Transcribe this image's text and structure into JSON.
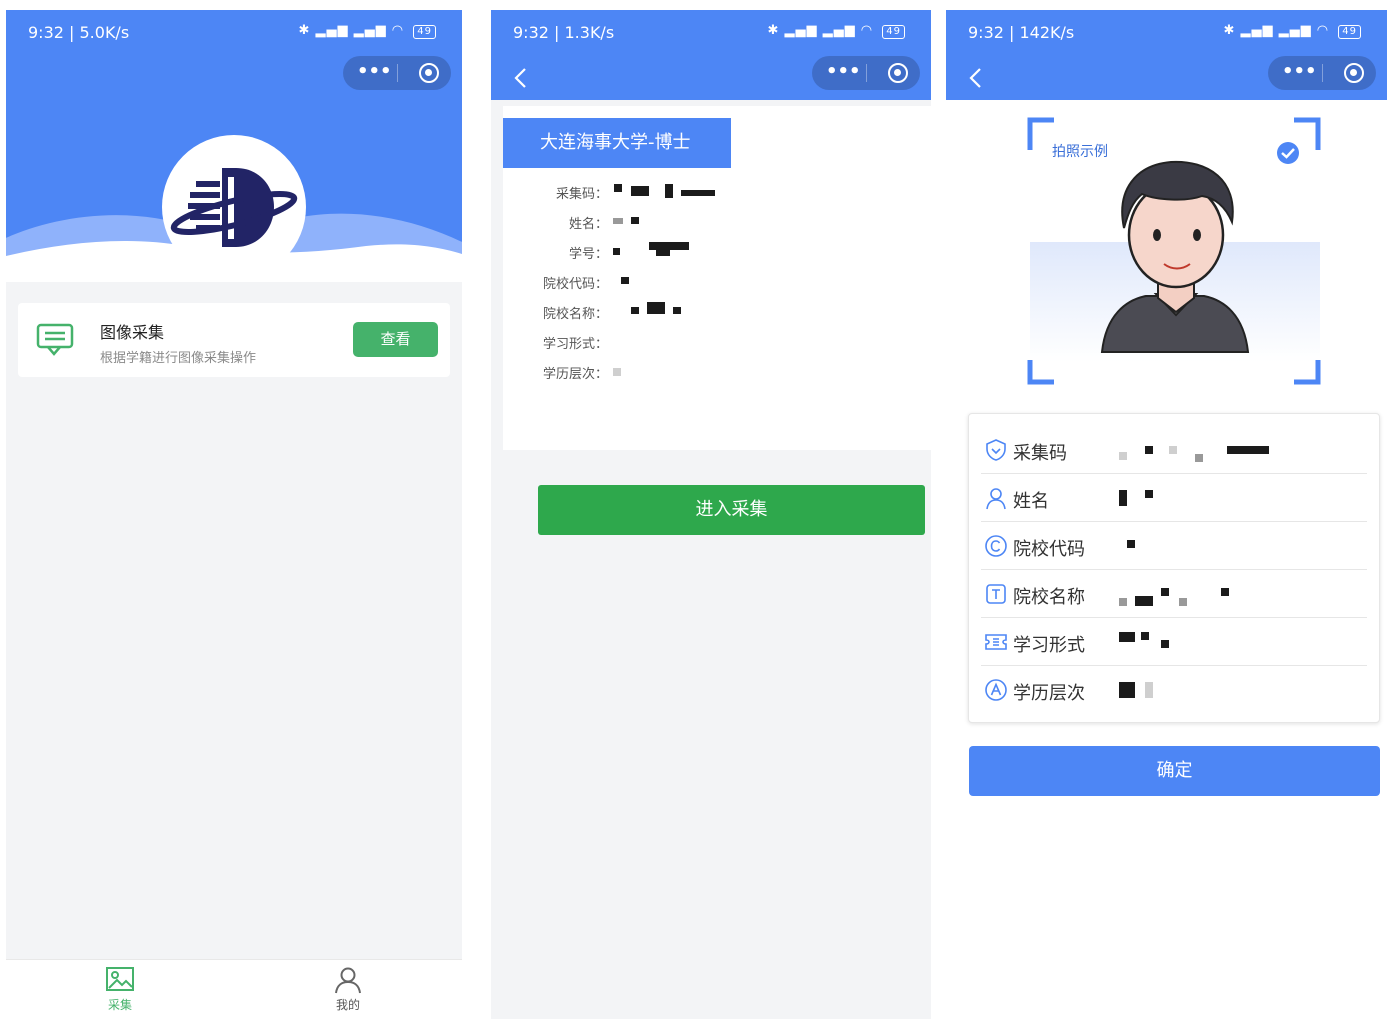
{
  "status_bars": [
    {
      "time": "9:32 | 5.0K/s",
      "battery": "49"
    },
    {
      "time": "9:32 | 1.3K/s",
      "battery": "49"
    },
    {
      "time": "9:32 | 142K/s",
      "battery": "49"
    }
  ],
  "capsule": {
    "more_icon": "more-dots-icon",
    "close_icon": "target-circle-icon"
  },
  "screen1": {
    "card": {
      "title": "图像采集",
      "subtitle": "根据学籍进行图像采集操作",
      "view_button": "查看"
    },
    "tabs": [
      {
        "label": "采集",
        "icon": "image-icon",
        "active": true
      },
      {
        "label": "我的",
        "icon": "user-icon",
        "active": false
      }
    ],
    "colors": {
      "brand_blue": "#4d86f5",
      "accent_green": "#45b26b",
      "logo_navy": "#222466"
    }
  },
  "screen2": {
    "school_title": "大连海事大学-博士",
    "fields": [
      {
        "label": "采集码："
      },
      {
        "label": "姓名："
      },
      {
        "label": "学号："
      },
      {
        "label": "院校代码："
      },
      {
        "label": "院校名称："
      },
      {
        "label": "学习形式："
      },
      {
        "label": "学历层次："
      }
    ],
    "enter_button": "进入采集"
  },
  "screen3": {
    "sample_label": "拍照示例",
    "rows": [
      {
        "label": "采集码",
        "icon": "shield-icon"
      },
      {
        "label": "姓名",
        "icon": "person-icon"
      },
      {
        "label": "院校代码",
        "icon": "copyright-icon"
      },
      {
        "label": "院校名称",
        "icon": "text-t-icon"
      },
      {
        "label": "学习形式",
        "icon": "ticket-icon"
      },
      {
        "label": "学历层次",
        "icon": "letter-a-icon"
      }
    ],
    "ok_button": "确定"
  }
}
